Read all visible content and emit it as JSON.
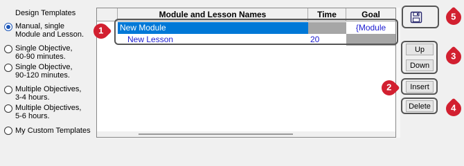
{
  "templates": {
    "heading": "Design Templates",
    "options": [
      {
        "line1": "Manual, single",
        "line2": "Module and Lesson.",
        "selected": true
      },
      {
        "line1": "Single Objective,",
        "line2": "60-90 minutes.",
        "selected": false
      },
      {
        "line1": "Single Objective,",
        "line2": "90-120 minutes.",
        "selected": false
      },
      {
        "line1": "Multiple Objectives,",
        "line2": "3-4 hours.",
        "selected": false
      },
      {
        "line1": "Multiple Objectives,",
        "line2": "5-6 hours.",
        "selected": false
      },
      {
        "line1": "My Custom Templates",
        "line2": "",
        "selected": false
      }
    ]
  },
  "grid": {
    "columns": [
      "Module and Lesson Names",
      "Time",
      "Goal"
    ],
    "rows": [
      {
        "name": "New Module",
        "time": "",
        "goal": "{Module Goal}"
      },
      {
        "name": "New Lesson",
        "time": "20",
        "goal": ""
      }
    ]
  },
  "buttons": {
    "save_icon": "floppy-disk-icon",
    "up": "Up",
    "down": "Down",
    "insert": "Insert",
    "delete": "Delete"
  },
  "markers": [
    "1",
    "2",
    "3",
    "4",
    "5"
  ],
  "colors": {
    "selected_row": "#0078d7",
    "cell_text": "#1a1ad0",
    "marker": "#d22030",
    "grey_cell": "#a6a6a6"
  }
}
